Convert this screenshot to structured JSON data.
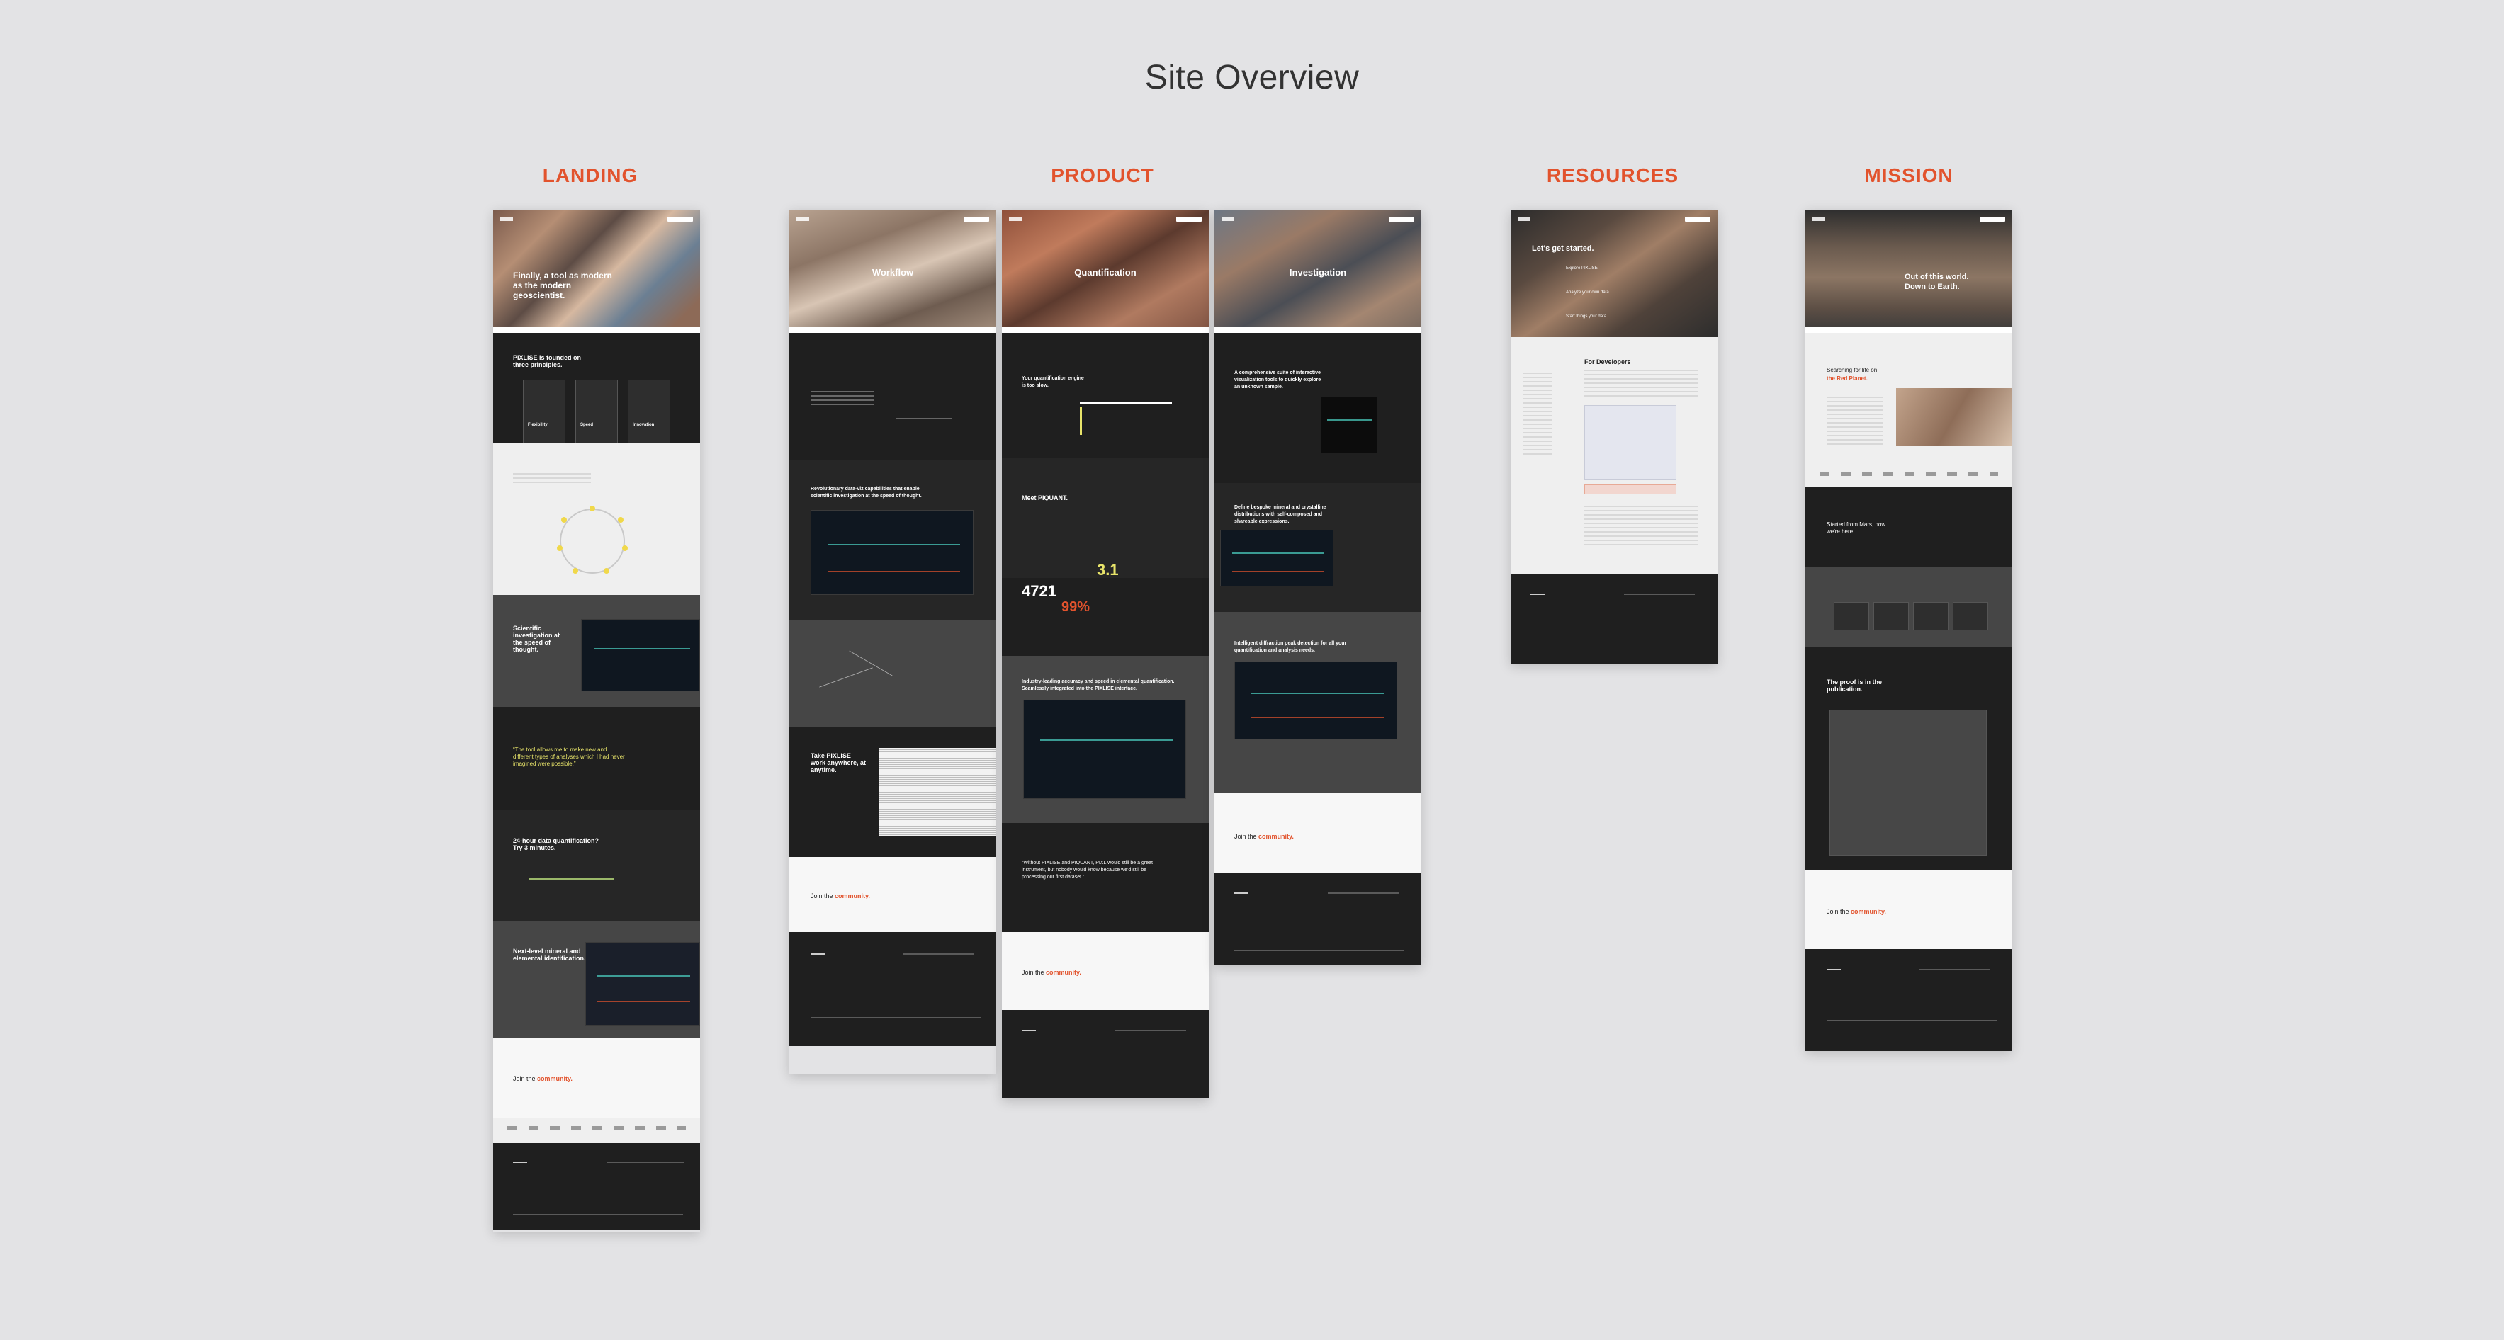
{
  "page": {
    "title": "Site Overview"
  },
  "sections": {
    "landing": "LANDING",
    "product": "PRODUCT",
    "resources": "RESOURCES",
    "mission": "MISSION"
  },
  "landing": {
    "hero": "Finally, a tool as modern as the modern geoscientist.",
    "principles_title": "PIXLISE is founded on three principles.",
    "principle_cards": [
      "Flexibility",
      "Speed",
      "Innovation"
    ],
    "speed_title": "Scientific investigation at the speed of thought.",
    "quote": "“The tool allows me to make new and different types of analyses which I had never imagined were possible.”",
    "quant_title": "24-hour data quantification? Try 3 minutes.",
    "id_title": "Next-level mineral and elemental identification.",
    "join_prefix": "Join the ",
    "join_highlight": "community."
  },
  "product": {
    "workflow": {
      "hero": "Workflow",
      "speed": "Revolutionary data-viz capabilities that enable scientific investigation at the speed of thought.",
      "share": "Take PIXLISE work anywhere, at anytime.",
      "join_prefix": "Join the ",
      "join_highlight": "community."
    },
    "quantification": {
      "hero": "Quantification",
      "engine": "Your quantification engine is too slow.",
      "meet": "Meet PIQUANT.",
      "stat1": "3.1",
      "stat2": "4721",
      "stat3": "99%",
      "accuracy": "Industry-leading accuracy and speed in elemental quantification. Seamlessly integrated into the PIXLISE interface.",
      "quote": "“Without PIXLISE and PIQUANT, PIXL would still be a great instrument, but nobody would know because we'd still be processing our first dataset.”",
      "join_prefix": "Join the ",
      "join_highlight": "community."
    },
    "investigation": {
      "hero": "Investigation",
      "suite": "A comprehensive suite of interactive visualization tools to quickly explore an unknown sample.",
      "define": "Define bespoke mineral and crystalline distributions with self-composed and shareable expressions.",
      "diffraction": "Intelligent diffraction peak detection for all your quantification and analysis needs.",
      "join_prefix": "Join the ",
      "join_highlight": "community."
    }
  },
  "resources": {
    "hero": "Let's get started.",
    "steps": [
      "Explore PIXLISE",
      "Analyze your own data",
      "Start things your data"
    ],
    "dev_title": "For Developers"
  },
  "mission": {
    "hero": "Out of this world. Down to Earth.",
    "search": "Searching for life on",
    "search_highlight": "the Red Planet.",
    "started": "Started from Mars, now we're here.",
    "proof": "The proof is in the publication.",
    "join_prefix": "Join the ",
    "join_highlight": "community."
  },
  "brand": {
    "accent": "#e2532d",
    "dark": "#1f1f1f",
    "highlight": "#e8e46a"
  }
}
